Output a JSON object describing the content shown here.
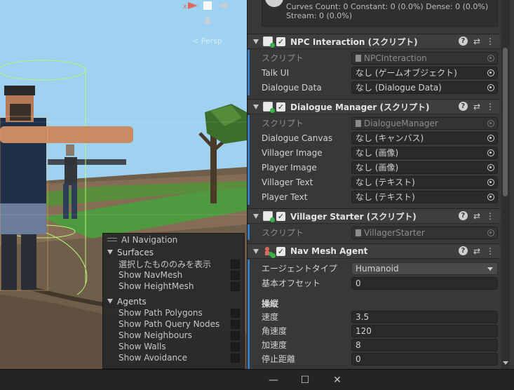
{
  "scene": {
    "persp_label": "< Persp"
  },
  "ai_nav": {
    "title": "AI Navigation",
    "surfaces": {
      "label": "Surfaces",
      "options": [
        "選択したもののみを表示",
        "Show NavMesh",
        "Show HeightMesh"
      ]
    },
    "agents": {
      "label": "Agents",
      "options": [
        "Show Path Polygons",
        "Show Path Query Nodes",
        "Show Neighbours",
        "Show Walls",
        "Show Avoidance"
      ]
    }
  },
  "inspector": {
    "curves_info": "Curves Count: 0 Constant: 0 (0.0%) Dense: 0 (0.0%) Stream: 0 (0.0%)",
    "npc": {
      "title": "NPC Interaction (スクリプト)",
      "script_label": "スクリプト",
      "script_value": "NPCInteraction",
      "talk_ui_label": "Talk UI",
      "talk_ui_value": "なし (ゲームオブジェクト)",
      "dialogue_data_label": "Dialogue Data",
      "dialogue_data_value": "なし (Dialogue Data)"
    },
    "dialogue": {
      "title": "Dialogue Manager (スクリプト)",
      "script_label": "スクリプト",
      "script_value": "DialogueManager",
      "fields": [
        {
          "label": "Dialogue Canvas",
          "value": "なし (キャンバス)"
        },
        {
          "label": "Villager Image",
          "value": "なし (画像)"
        },
        {
          "label": "Player Image",
          "value": "なし (画像)"
        },
        {
          "label": "Villager Text",
          "value": "なし (テキスト)"
        },
        {
          "label": "Player Text",
          "value": "なし (テキスト)"
        }
      ]
    },
    "villager": {
      "title": "Villager Starter (スクリプト)",
      "script_label": "スクリプト",
      "script_value": "VillagerStarter"
    },
    "navmesh": {
      "title": "Nav Mesh Agent",
      "agent_type_label": "エージェントタイプ",
      "agent_type_value": "Humanoid",
      "base_offset_label": "基本オフセット",
      "base_offset_value": "0",
      "steering_label": "操縦",
      "speed_label": "速度",
      "speed_value": "3.5",
      "angular_label": "角速度",
      "angular_value": "120",
      "accel_label": "加速度",
      "accel_value": "8",
      "stop_label": "停止距離",
      "stop_value": "0"
    }
  },
  "window": {
    "minimize": "—",
    "maximize": "☐",
    "close": "✕"
  }
}
